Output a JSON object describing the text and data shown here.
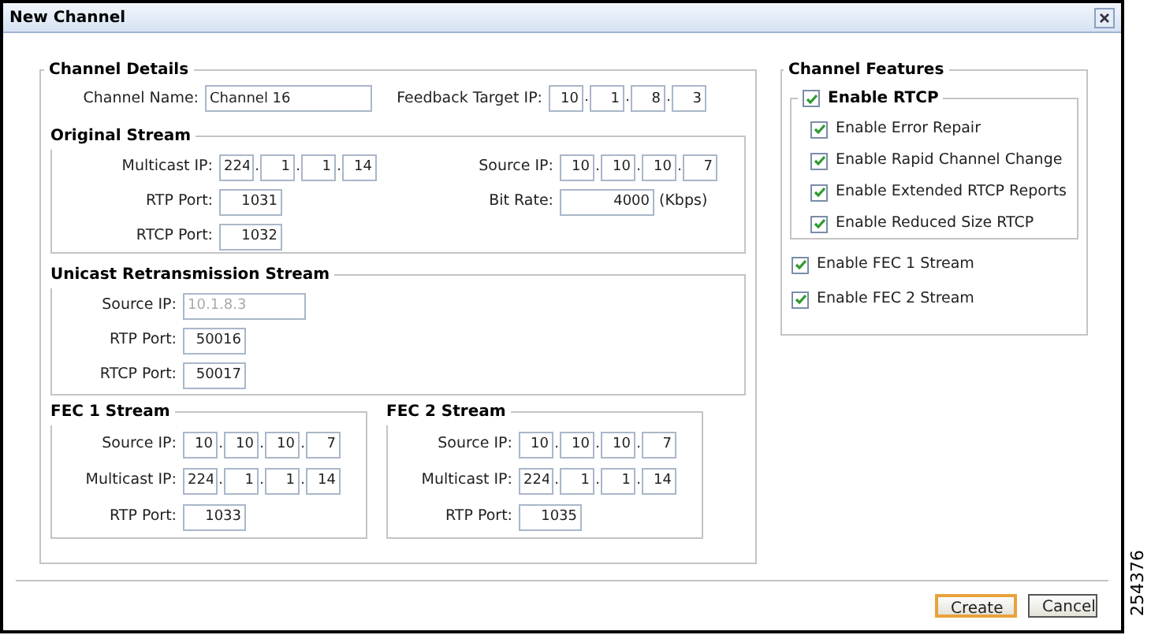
{
  "window": {
    "title": "New Channel"
  },
  "channel_details": {
    "legend": "Channel Details",
    "fields": [
      {
        "label": "Channel Name:",
        "kind": "text",
        "value": "Channel 16"
      },
      {
        "label": "Feedback Target IP:",
        "kind": "ip",
        "octets": [
          "10",
          "1",
          "8",
          "3"
        ],
        "separator": "."
      }
    ]
  },
  "original_stream": {
    "legend": "Original Stream",
    "left_fields": [
      {
        "label": "Multicast IP:",
        "kind": "ip",
        "octets": [
          "224",
          "1",
          "1",
          "14"
        ],
        "separator": "."
      },
      {
        "label": "RTP Port:",
        "kind": "port",
        "value": "1031"
      },
      {
        "label": "RTCP Port:",
        "kind": "port",
        "value": "1032"
      }
    ],
    "right_fields": [
      {
        "label": "Source IP:",
        "kind": "ip",
        "octets": [
          "10",
          "10",
          "10",
          "7"
        ],
        "separator": "."
      },
      {
        "label": "Bit Rate:",
        "kind": "rate",
        "value": "4000",
        "unit": "(Kbps)"
      }
    ]
  },
  "unicast_stream": {
    "legend": "Unicast Retransmission Stream",
    "fields": [
      {
        "label": "Source IP:",
        "kind": "address",
        "value": "10.1.8.3",
        "disabled": true
      },
      {
        "label": "RTP Port:",
        "kind": "port",
        "value": "50016",
        "disabled": false
      },
      {
        "label": "RTCP Port:",
        "kind": "port",
        "value": "50017",
        "disabled": false
      }
    ]
  },
  "fec_streams": [
    {
      "legend": "FEC 1 Stream",
      "fields": [
        {
          "label": "Source IP:",
          "kind": "ip",
          "octets": [
            "10",
            "10",
            "10",
            "7"
          ],
          "separator": "."
        },
        {
          "label": "Multicast IP:",
          "kind": "ip",
          "octets": [
            "224",
            "1",
            "1",
            "14"
          ],
          "separator": "."
        },
        {
          "label": "RTP Port:",
          "kind": "port",
          "value": "1033"
        }
      ]
    },
    {
      "legend": "FEC 2 Stream",
      "fields": [
        {
          "label": "Source IP:",
          "kind": "ip",
          "octets": [
            "10",
            "10",
            "10",
            "7"
          ],
          "separator": "."
        },
        {
          "label": "Multicast IP:",
          "kind": "ip",
          "octets": [
            "224",
            "1",
            "1",
            "14"
          ],
          "separator": "."
        },
        {
          "label": "RTP Port:",
          "kind": "port",
          "value": "1035"
        }
      ]
    }
  ],
  "channel_features": {
    "legend": "Channel Features",
    "rtcp": {
      "label": "Enable RTCP",
      "checked": true,
      "options": [
        {
          "label": "Enable Error Repair",
          "checked": true
        },
        {
          "label": "Enable Rapid Channel Change",
          "checked": true
        },
        {
          "label": "Enable Extended RTCP Reports",
          "checked": true
        },
        {
          "label": "Enable Reduced Size RTCP",
          "checked": true
        }
      ]
    },
    "options": [
      {
        "label": "Enable FEC 1 Stream",
        "checked": true
      },
      {
        "label": "Enable FEC 2 Stream",
        "checked": true
      }
    ]
  },
  "buttons": [
    {
      "label": "Create",
      "default": true
    },
    {
      "label": "Cancel",
      "default": false
    }
  ],
  "figure_id": "254376"
}
